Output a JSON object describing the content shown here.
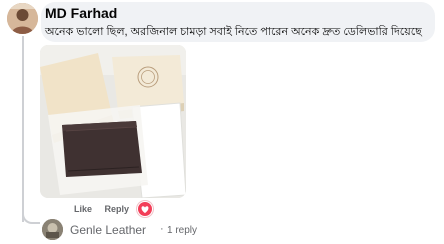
{
  "comment": {
    "author": "MD Farhad",
    "text": "অনেক ভালো ছিল, অরজিনাল চামড়া সবাই নিতে পারেন অনেক দ্রুত ডেলিভারি দিয়েছে",
    "avatar_icon": "user-avatar-photo",
    "photo_icon": "wallet-product-photo"
  },
  "actions": {
    "like_label": "Like",
    "reply_label": "Reply",
    "reaction_icon": "love-reaction-icon",
    "reaction_color": "#f33e58"
  },
  "reply_preview": {
    "author": "Genle Leather",
    "separator": "·",
    "count_label": "1 reply",
    "avatar_icon": "page-avatar"
  },
  "colors": {
    "bubble": "#f0f2f5",
    "secondary_text": "#65676b",
    "thread_line": "#ced0d4"
  }
}
